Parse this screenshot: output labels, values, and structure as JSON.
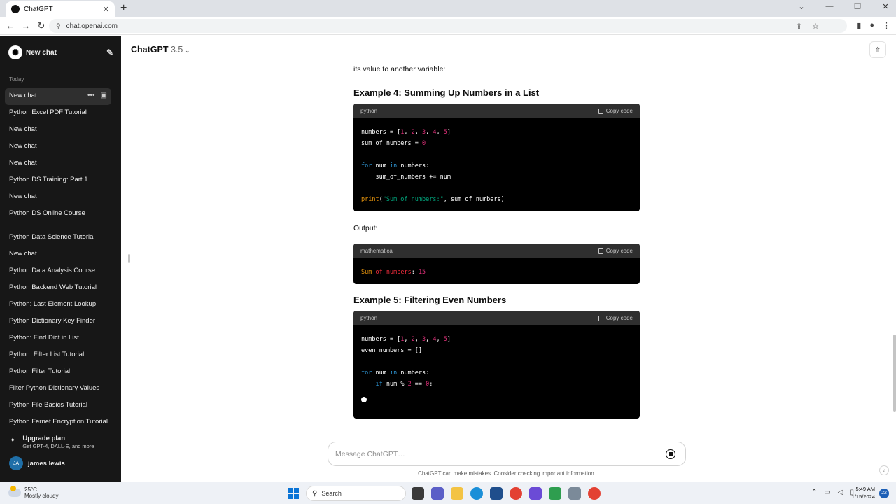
{
  "browser": {
    "tab_title": "ChatGPT",
    "url": "chat.openai.com"
  },
  "sidebar": {
    "new_chat": "New chat",
    "section_today": "Today",
    "items": [
      {
        "label": "New chat"
      },
      {
        "label": "Python Excel PDF Tutorial"
      },
      {
        "label": "New chat"
      },
      {
        "label": "New chat"
      },
      {
        "label": "New chat"
      },
      {
        "label": "Python DS Training: Part 1"
      },
      {
        "label": "New chat"
      },
      {
        "label": "Python DS Online Course"
      },
      {
        "label": "Python Data Science Tutorial"
      },
      {
        "label": "New chat"
      },
      {
        "label": "Python Data Analysis Course"
      },
      {
        "label": "Python Backend Web Tutorial"
      },
      {
        "label": "Python: Last Element Lookup"
      },
      {
        "label": "Python Dictionary Key Finder"
      },
      {
        "label": "Python: Find Dict in List"
      },
      {
        "label": "Python: Filter List Tutorial"
      },
      {
        "label": "Python Filter Tutorial"
      },
      {
        "label": "Filter Python Dictionary Values"
      },
      {
        "label": "Python File Basics Tutorial"
      },
      {
        "label": "Python Fernet Encryption Tutorial"
      }
    ],
    "upgrade_title": "Upgrade plan",
    "upgrade_sub": "Get GPT-4, DALL·E, and more",
    "user_initials": "JA",
    "user_name": "james lewis"
  },
  "header": {
    "model": "ChatGPT",
    "version": "3.5"
  },
  "conversation": {
    "intro_text": "its value to another variable:",
    "example4_title": "Example 4: Summing Up Numbers in a List",
    "output_label": "Output:",
    "example5_title": "Example 5: Filtering Even Numbers",
    "copy_label": "Copy code",
    "code1_lang": "python",
    "code2_lang": "mathematica",
    "code3_lang": "python"
  },
  "composer": {
    "placeholder": "Message ChatGPT…",
    "disclaimer": "ChatGPT can make mistakes. Consider checking important information."
  },
  "taskbar": {
    "temp": "25°C",
    "weather": "Mostly cloudy",
    "search": "Search",
    "time": "5:49 AM",
    "date": "1/15/2024",
    "notifications": "22"
  }
}
